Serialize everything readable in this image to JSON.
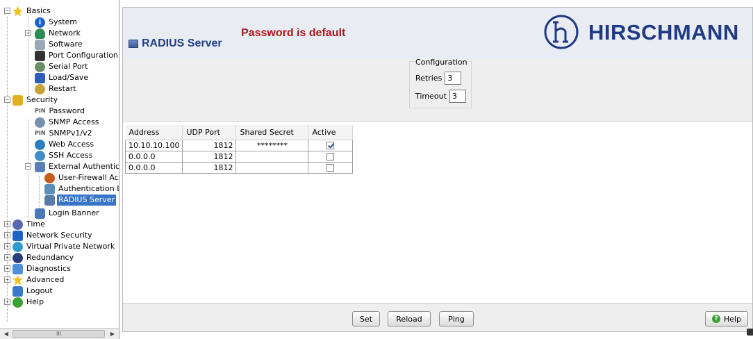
{
  "sidebar": {
    "items": [
      {
        "label": "Basics",
        "icon": "star-icon",
        "color": "#f2c21a"
      },
      {
        "label": "System",
        "icon": "info-icon",
        "color": "#1e64c8"
      },
      {
        "label": "Network",
        "icon": "network-icon",
        "color": "#2e8b57"
      },
      {
        "label": "Software",
        "icon": "software-icon",
        "color": "#9aa8b8"
      },
      {
        "label": "Port Configuration",
        "icon": "port-icon",
        "color": "#333333"
      },
      {
        "label": "Serial Port",
        "icon": "serial-port-icon",
        "color": "#6b8e6b"
      },
      {
        "label": "Load/Save",
        "icon": "save-icon",
        "color": "#2f5db3"
      },
      {
        "label": "Restart",
        "icon": "restart-icon",
        "color": "#c8a23a"
      },
      {
        "label": "Security",
        "icon": "lock-icon",
        "color": "#e0b020"
      },
      {
        "label": "Password",
        "icon": "pin-icon",
        "color": "#555555",
        "prefix": "PIN"
      },
      {
        "label": "SNMP Access",
        "icon": "snmp-icon",
        "color": "#7a8fb0"
      },
      {
        "label": "SNMPv1/v2",
        "icon": "pin-icon",
        "color": "#555555",
        "prefix": "PIN"
      },
      {
        "label": "Web Access",
        "icon": "web-icon",
        "color": "#2f7fc0"
      },
      {
        "label": "SSH Access",
        "icon": "ssh-icon",
        "color": "#3c8dc8"
      },
      {
        "label": "External Authenticat",
        "icon": "external-auth-icon",
        "color": "#5a7fb8"
      },
      {
        "label": "User-Firewall Ac",
        "icon": "firewall-icon",
        "color": "#c85a1e"
      },
      {
        "label": "Authentication L",
        "icon": "auth-list-icon",
        "color": "#5a8fb8"
      },
      {
        "label": "RADIUS Server",
        "icon": "server-icon",
        "color": "#5a7aa8"
      },
      {
        "label": "Login Banner",
        "icon": "banner-icon",
        "color": "#4a78b8"
      },
      {
        "label": "Time",
        "icon": "clock-icon",
        "color": "#5a68b0"
      },
      {
        "label": "Network Security",
        "icon": "network-security-icon",
        "color": "#1e64c8"
      },
      {
        "label": "Virtual Private Network",
        "icon": "vpn-icon",
        "color": "#2f9ad0"
      },
      {
        "label": "Redundancy",
        "icon": "redundancy-icon",
        "color": "#2a3f7a"
      },
      {
        "label": "Diagnostics",
        "icon": "diagnostics-icon",
        "color": "#4f8ed8"
      },
      {
        "label": "Advanced",
        "icon": "star-icon",
        "color": "#f2c21a"
      },
      {
        "label": "Logout",
        "icon": "logout-icon",
        "color": "#3a78c8"
      },
      {
        "label": "Help",
        "icon": "help-icon",
        "color": "#3aa133"
      }
    ],
    "scroll_thumb": "III"
  },
  "header": {
    "title": "RADIUS Server",
    "warning": "Password is default",
    "brand": "HIRSCHMANN",
    "warning_color": "#b0161c",
    "brand_color": "#1e3a86"
  },
  "config": {
    "legend": "Configuration",
    "retries_label": "Retries",
    "retries_value": "3",
    "timeout_label": "Timeout",
    "timeout_value": "3"
  },
  "table": {
    "headers": [
      "Address",
      "UDP Port",
      "Shared Secret",
      "Active"
    ],
    "rows": [
      {
        "address": "10.10.10.100",
        "port": "1812",
        "secret": "********",
        "active": true
      },
      {
        "address": "0.0.0.0",
        "port": "1812",
        "secret": "",
        "active": false
      },
      {
        "address": "0.0.0.0",
        "port": "1812",
        "secret": "",
        "active": false
      }
    ]
  },
  "buttons": {
    "set": "Set",
    "reload": "Reload",
    "ping": "Ping",
    "help": "Help"
  }
}
